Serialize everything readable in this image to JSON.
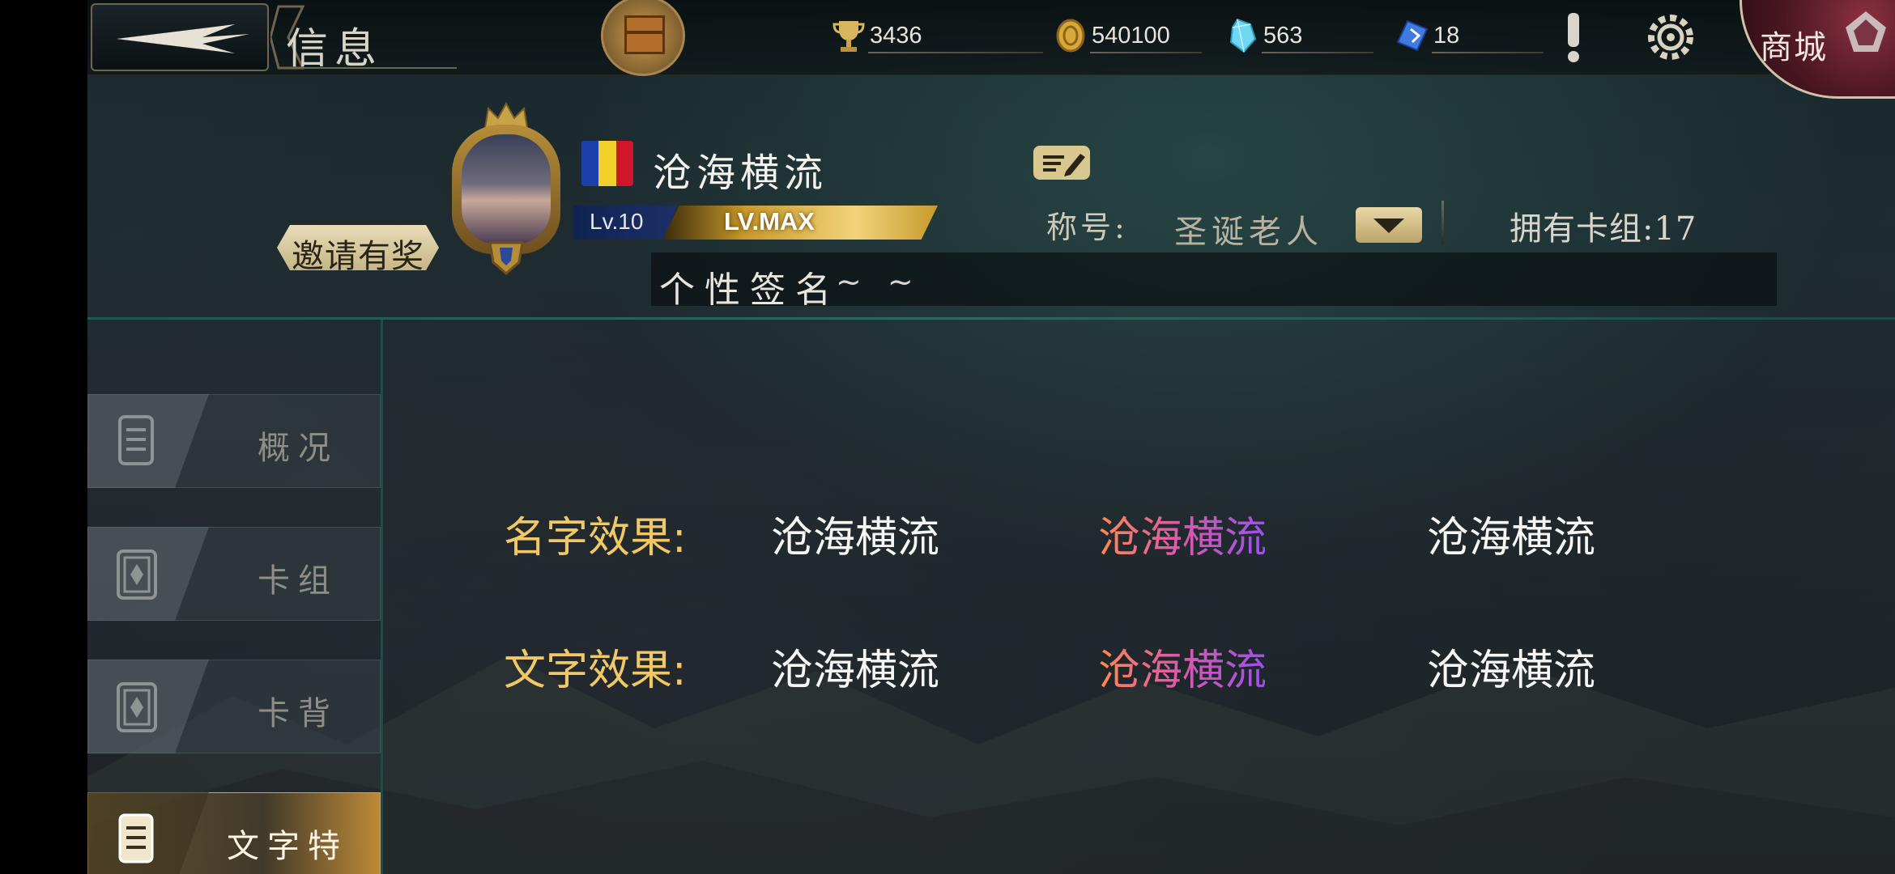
{
  "header": {
    "title": "信息",
    "resources": [
      {
        "name": "trophy",
        "icon": "trophy-icon",
        "value": "3436"
      },
      {
        "name": "gold",
        "icon": "coin-icon",
        "value": "540100"
      },
      {
        "name": "crystal",
        "icon": "crystal-icon",
        "value": "563"
      },
      {
        "name": "ticket",
        "icon": "ticket-icon",
        "value": "18"
      }
    ],
    "shop_label": "商城"
  },
  "profile": {
    "name": "沧海横流",
    "level": "Lv.10",
    "level_status": "LV.MAX",
    "invite_label": "邀请有奖",
    "title_label": "称号:",
    "title_value": "圣诞老人",
    "deck_count": "拥有卡组:17",
    "signature_label": "个性签名",
    "signature_value": "~ ~"
  },
  "sidebar": {
    "tabs": [
      {
        "label": "概况",
        "active": false
      },
      {
        "label": "卡组",
        "active": false
      },
      {
        "label": "卡背",
        "active": false
      },
      {
        "label": "文字特效",
        "active": true
      }
    ]
  },
  "effects": {
    "rows": [
      {
        "label": "名字效果:",
        "options": [
          "沧海横流",
          "沧海横流",
          "沧海横流"
        ]
      },
      {
        "label": "文字效果:",
        "options": [
          "沧海横流",
          "沧海横流",
          "沧海横流"
        ]
      }
    ]
  },
  "colors": {
    "accent_gold": "#f0c866",
    "gradient_start": "#ff8a50",
    "gradient_end": "#9b4ff0"
  }
}
